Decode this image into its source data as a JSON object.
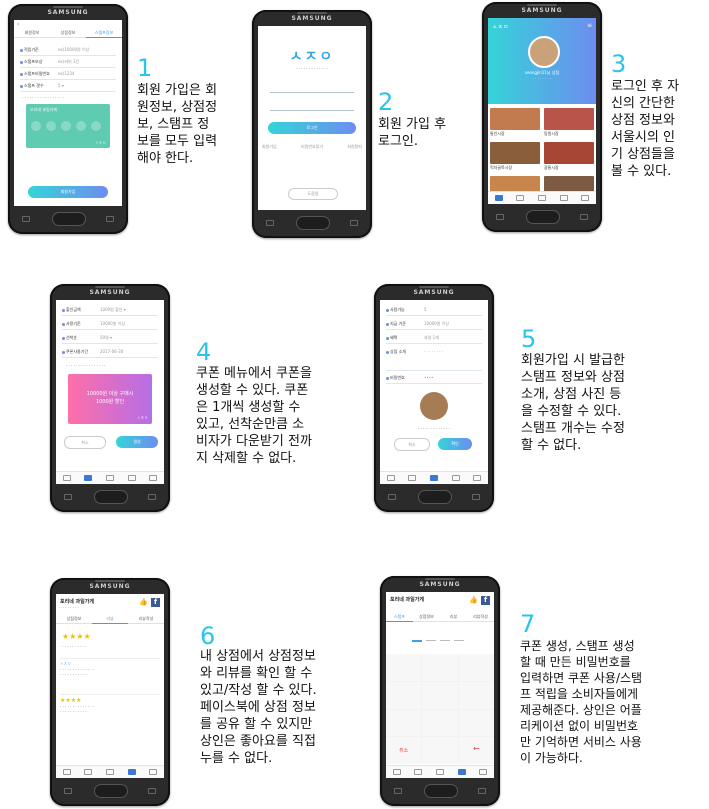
{
  "phone_brand": "SAMSUNG",
  "steps": [
    {
      "num": "1",
      "caption": "회원 가입은 회원정보, 상점정보, 스탬프 정보를 모두 입력해야 한다."
    },
    {
      "num": "2",
      "caption": "회원 가입 후 로그인."
    },
    {
      "num": "3",
      "caption": "로그인 후 자신의 간단한 상점 정보와 서울시의 인기 상점들을 볼 수 있다."
    },
    {
      "num": "4",
      "caption": "쿠폰 메뉴에서 쿠폰을 생성할 수 있다. 쿠폰은 1개씩 생성할 수 있고, 선착순만큼 소비자가 다운받기 전까지 삭제할 수 없다."
    },
    {
      "num": "5",
      "caption": "회원가입 시 발급한 스탬프 정보와 상점 소개, 상점 사진 등을 수정할 수 있다. 스탬프 개수는 수정할 수 없다."
    },
    {
      "num": "6",
      "caption": "내 상점에서 상점정보와 리뷰를 확인 할 수 있고/작성 할 수 있다. 페이스북에 상점 정보를 공유 할 수 있지만 상인은 좋아요를 직접 누를 수 없다."
    },
    {
      "num": "7",
      "caption": "쿠폰 생성, 스탬프 생성할 때 만든 비밀번호를 입력하면 쿠폰 사용/스탬프 적립을 소비자들에게 제공해준다. 상인은 어플리케이션 없이 비밀번호만 기억하면 서비스 사용이 가능하다."
    }
  ],
  "caption_lines": {
    "s1": [
      "회원 가입은 회",
      "원정보, 상점정",
      "보, 스탬프 정",
      "보를 모두 입력",
      "해야 한다."
    ],
    "s2": [
      "회원 가입 후",
      "로그인."
    ],
    "s3": [
      "로그인 후 자",
      "신의 간단한",
      "상점 정보와",
      "서울시의 인",
      "기 상점들을",
      "볼 수 있다."
    ],
    "s4": [
      "쿠폰 메뉴에서 쿠폰을",
      "생성할 수 있다. 쿠폰",
      "은 1개씩 생성할 수",
      "있고, 선착순만큼 소",
      "비자가 다운받기 전까",
      "지 삭제할 수 없다."
    ],
    "s5": [
      "회원가입 시 발급한",
      "스탬프 정보와 상점",
      "소개, 상점 사진 등",
      "을 수정할 수 있다.",
      "스탬프 개수는 수정",
      "할 수 없다."
    ],
    "s6": [
      "내 상점에서 상점정보",
      "와 리뷰를 확인 할 수",
      "있고/작성 할 수 있다.",
      "페이스북에 상점 정보",
      "를 공유 할 수 있지만",
      "상인은 좋아요를 직접",
      "누를 수 없다."
    ],
    "s7": [
      "쿠폰 생성, 스탬프 생성",
      "할 때 만든 비밀번호를",
      "입력하면 쿠폰 사용/스탬",
      "프 적립을 소비자들에게",
      "제공해준다. 상인은 어플",
      "리케이션 없이 비밀번호",
      "만 기억하면 서비스 사용",
      "이 가능하다."
    ]
  },
  "screens": {
    "signup": {
      "tabs": [
        "회원정보",
        "상점정보",
        "스탬프정보"
      ],
      "card_title": "오리네 과일가게",
      "button": "회원가입",
      "logo": "ㅅㅈㅇ"
    },
    "login": {
      "logo": "ㅅㅈㅇ",
      "button": "로그인",
      "links": [
        "회원가입",
        "비밀번호찾기",
        "회원탈퇴"
      ],
      "footer_btn": "도움말"
    },
    "main": {
      "logo": "ㅅㅈㅇ",
      "shop_name": "seongjin11님 상점",
      "tiles": [
        "통인시장",
        "망원시장",
        "먹자골목시장",
        "광통시장"
      ]
    },
    "coupon": {
      "fields": [
        "할인금액",
        "사용기준",
        "선착순",
        "쿠폰사용기간"
      ],
      "card_line1": "10000원 이상 구매시",
      "card_line2": "1000원 할인",
      "cancel": "취소",
      "create": "생성",
      "logo": "ㅅㅈㅇ"
    },
    "edit": {
      "fields": [
        "사용가능",
        "지급 기준",
        "혜택",
        "상점 소개",
        "비밀번호"
      ],
      "cancel": "취소",
      "confirm": "확인"
    },
    "shop": {
      "title": "포리네 과일가게",
      "tabs": [
        "상점정보",
        "리뷰",
        "리뷰작성"
      ],
      "logo": "ㅅㅈㅇ"
    },
    "pin": {
      "title": "포리네 과일가게",
      "tabs": [
        "스탬프",
        "상점정보",
        "리뷰",
        "리뷰작성"
      ],
      "cancel": "취소"
    }
  },
  "colors": {
    "accent": "#29c5e8",
    "gradient_start": "#35d3d8",
    "gradient_end": "#6d8df0"
  }
}
